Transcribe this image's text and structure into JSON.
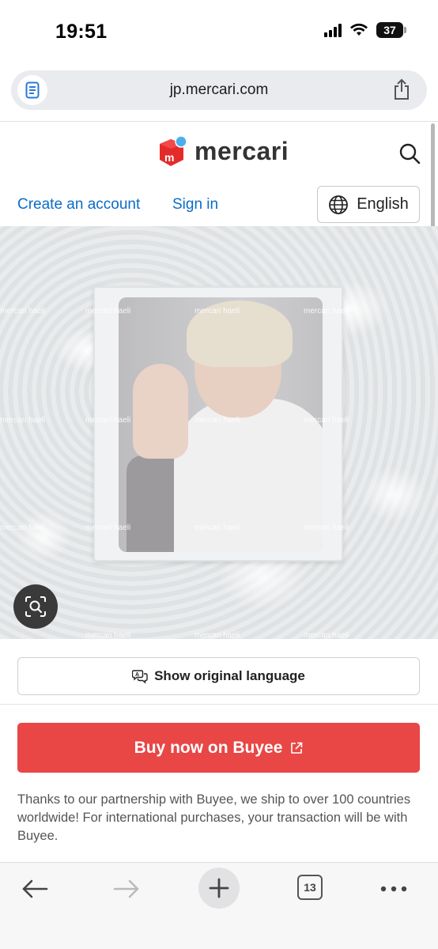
{
  "status_bar": {
    "time": "19:51",
    "battery": "37"
  },
  "browser": {
    "url": "jp.mercari.com"
  },
  "header": {
    "logo_text": "mercari",
    "create_account": "Create an account",
    "sign_in": "Sign in",
    "language": "English"
  },
  "product_image": {
    "watermark": "mercari haeli"
  },
  "actions": {
    "show_original": "Show original language",
    "buy_now": "Buy now on Buyee"
  },
  "notice": {
    "text": "Thanks to our partnership with Buyee, we ship to over 100 countries worldwide! For international purchases, your transaction will be with Buyee."
  },
  "toolbar": {
    "tab_count": "13"
  },
  "colors": {
    "accent_red": "#e94646",
    "link_blue": "#0b6cc8"
  }
}
